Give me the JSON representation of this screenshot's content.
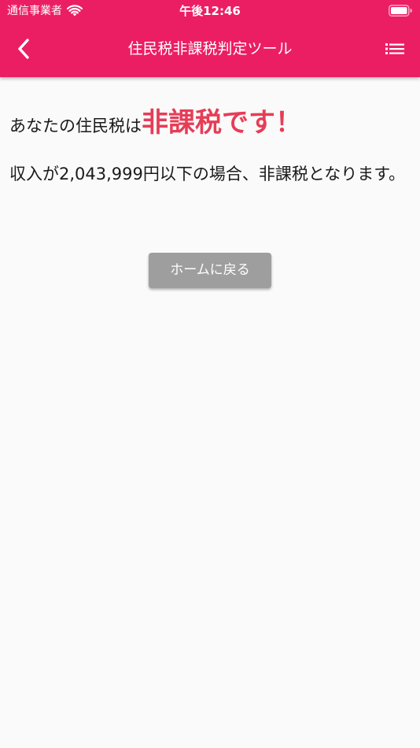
{
  "status_bar": {
    "carrier": "通信事業者",
    "time": "午後12:46",
    "wifi_icon": "wifi-icon",
    "battery_icon": "battery-icon"
  },
  "nav": {
    "title": "住民税非課税判定ツール",
    "back_icon": "chevron-left-icon",
    "menu_icon": "list-menu-icon"
  },
  "result": {
    "prefix": "あなたの住民税は",
    "status": "非課税です！"
  },
  "income": {
    "text": "収入が2,043,999円以下の場合、非課税となります。"
  },
  "buttons": {
    "home_label": "ホームに戻る"
  },
  "colors": {
    "header": "#ec1e63",
    "accent_text": "#e63d57",
    "button": "#9e9e9e",
    "background": "#fafafa"
  }
}
